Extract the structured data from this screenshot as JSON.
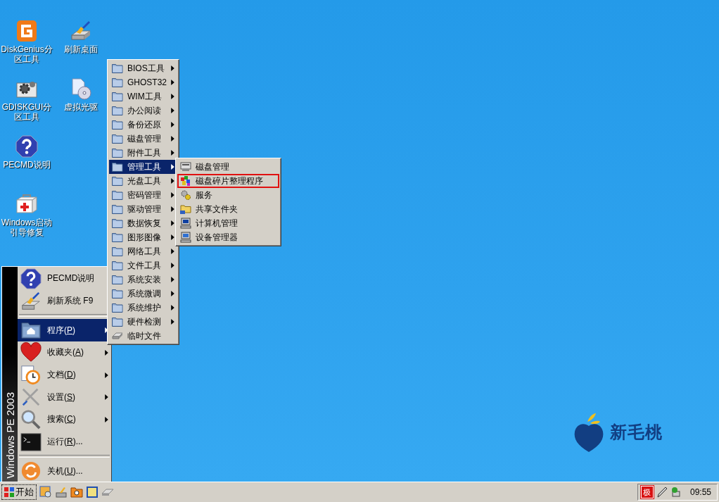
{
  "desktop_icons": [
    {
      "label": "DiskGenius分区工具"
    },
    {
      "label": "刷新桌面"
    },
    {
      "label": "GDISKGUI分区工具"
    },
    {
      "label": "虚拟光驱"
    },
    {
      "label": "PECMD说明"
    },
    {
      "label": "Windows启动引导修复"
    }
  ],
  "logo": {
    "text": "新毛桃"
  },
  "start_menu": {
    "banner": "Windows PE 2003",
    "top_items": [
      {
        "text_before": "PECMD说明"
      },
      {
        "text_before": "刷新系统 F9"
      }
    ],
    "main_items": [
      {
        "text_before": "程序(",
        "accelerator": "P",
        "text_after": ")",
        "submenu": true,
        "selected": true
      },
      {
        "text_before": "收藏夹(",
        "accelerator": "A",
        "text_after": ")",
        "submenu": true,
        "selected": false
      },
      {
        "text_before": "文档(",
        "accelerator": "D",
        "text_after": ")",
        "submenu": true,
        "selected": false
      },
      {
        "text_before": "设置(",
        "accelerator": "S",
        "text_after": ")",
        "submenu": true,
        "selected": false
      },
      {
        "text_before": "搜索(",
        "accelerator": "C",
        "text_after": ")",
        "submenu": true,
        "selected": false
      },
      {
        "text_before": "运行(",
        "accelerator": "R",
        "text_after": ")...",
        "submenu": false,
        "selected": false
      }
    ],
    "bottom_items": [
      {
        "text_before": "关机(",
        "accelerator": "U",
        "text_after": ")...",
        "submenu": false,
        "selected": false
      }
    ]
  },
  "programs_menu": [
    {
      "label": "BIOS工具",
      "kind": "folder",
      "submenu": true,
      "selected": false
    },
    {
      "label": "GHOST32",
      "kind": "folder",
      "submenu": true,
      "selected": false
    },
    {
      "label": "WIM工具",
      "kind": "folder",
      "submenu": true,
      "selected": false
    },
    {
      "label": "办公阅读",
      "kind": "folder",
      "submenu": true,
      "selected": false
    },
    {
      "label": "备份还原",
      "kind": "folder",
      "submenu": true,
      "selected": false
    },
    {
      "label": "磁盘管理",
      "kind": "folder",
      "submenu": true,
      "selected": false
    },
    {
      "label": "附件工具",
      "kind": "folder",
      "submenu": true,
      "selected": false
    },
    {
      "label": "管理工具",
      "kind": "folder",
      "submenu": true,
      "selected": true
    },
    {
      "label": "光盘工具",
      "kind": "folder",
      "submenu": true,
      "selected": false
    },
    {
      "label": "密码管理",
      "kind": "folder",
      "submenu": true,
      "selected": false
    },
    {
      "label": "驱动管理",
      "kind": "folder",
      "submenu": true,
      "selected": false
    },
    {
      "label": "数据恢复",
      "kind": "folder",
      "submenu": true,
      "selected": false
    },
    {
      "label": "图形图像",
      "kind": "folder",
      "submenu": true,
      "selected": false
    },
    {
      "label": "网络工具",
      "kind": "folder",
      "submenu": true,
      "selected": false
    },
    {
      "label": "文件工具",
      "kind": "folder",
      "submenu": true,
      "selected": false
    },
    {
      "label": "系统安装",
      "kind": "folder",
      "submenu": true,
      "selected": false
    },
    {
      "label": "系统微调",
      "kind": "folder",
      "submenu": true,
      "selected": false
    },
    {
      "label": "系统维护",
      "kind": "folder",
      "submenu": true,
      "selected": false
    },
    {
      "label": "硬件检测",
      "kind": "folder",
      "submenu": true,
      "selected": false
    },
    {
      "label": "临时文件",
      "kind": "file",
      "submenu": false,
      "selected": false
    }
  ],
  "admin_menu": [
    {
      "label": "磁盘管理",
      "highlighted": false
    },
    {
      "label": "磁盘碎片整理程序",
      "highlighted": true
    },
    {
      "label": "服务",
      "highlighted": false
    },
    {
      "label": "共享文件夹",
      "highlighted": false
    },
    {
      "label": "计算机管理",
      "highlighted": false
    },
    {
      "label": "设备管理器",
      "highlighted": false
    }
  ],
  "taskbar": {
    "start_label": "开始",
    "tray_ime": "极",
    "clock": "09:55"
  }
}
